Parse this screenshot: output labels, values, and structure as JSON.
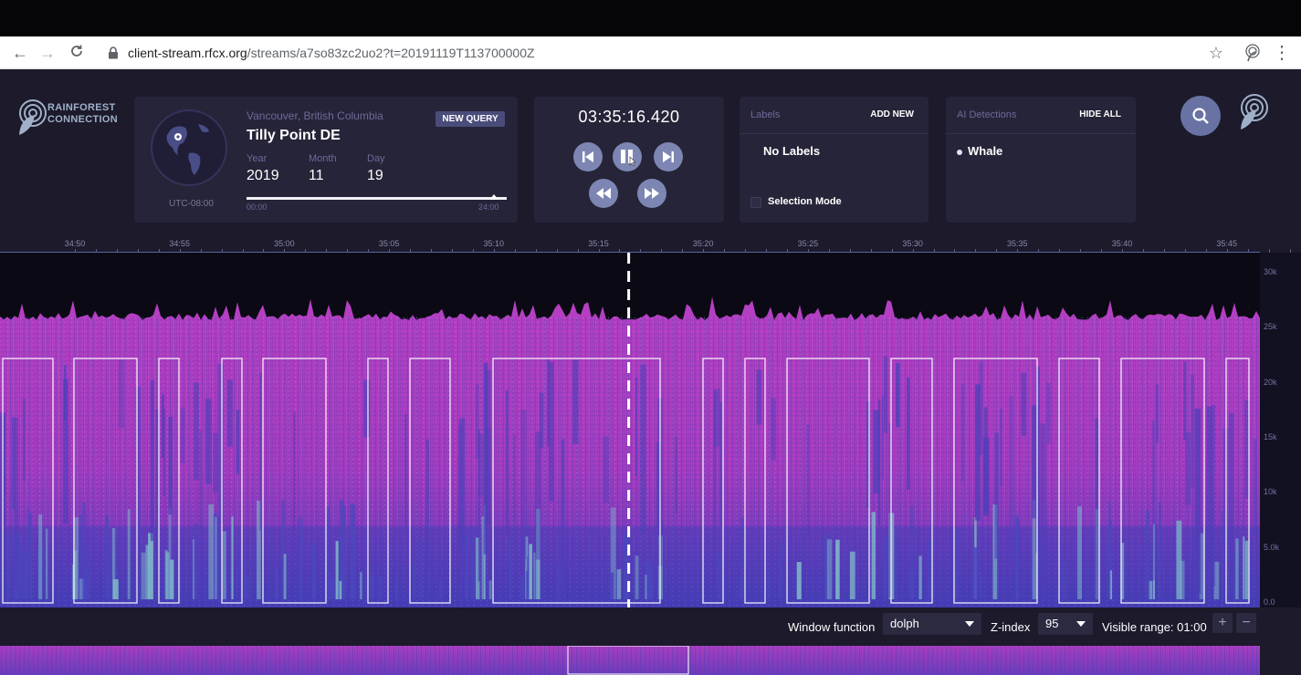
{
  "browser": {
    "url_host": "client-stream.rfcx.org",
    "url_path": "/streams/a7so83zc2uo2?t=20191119T113700000Z"
  },
  "brand": {
    "logo_line1": "RAINFOREST",
    "logo_line2": "CONNECTION",
    "accent": "#7d86b3",
    "panel_color": "#262438",
    "spectrogram_color": "#b63fc2"
  },
  "location": {
    "region": "Vancouver, British Columbia",
    "name": "Tilly Point DE",
    "new_query_label": "NEW QUERY",
    "timezone": "UTC-08:00",
    "year_label": "Year",
    "year": "2019",
    "month_label": "Month",
    "month": "11",
    "day_label": "Day",
    "day": "19",
    "timeline_start": "00:00",
    "timeline_end": "24:00",
    "timeline_position": 0.95
  },
  "player": {
    "time": "03:35:16.420"
  },
  "labels": {
    "title": "Labels",
    "add_label": "ADD NEW",
    "empty_text": "No Labels",
    "selection_mode_label": "Selection Mode"
  },
  "ai": {
    "title": "AI Detections",
    "hide_label": "HIDE ALL",
    "items": [
      "Whale"
    ]
  },
  "timeline_ticks": [
    "34:50",
    "34:55",
    "35:00",
    "35:05",
    "35:10",
    "35:15",
    "35:20",
    "35:25",
    "35:30",
    "35:35",
    "35:40",
    "35:45"
  ],
  "playhead_fraction": 0.499,
  "freq_axis": [
    "30k",
    "25k",
    "20k",
    "15k",
    "10k",
    "5.0k",
    "0.0"
  ],
  "controls": {
    "window_function_label": "Window function",
    "window_function_value": "dolph",
    "z_index_label": "Z-index",
    "z_index_value": "95",
    "visible_range_label": "Visible range: 01:00",
    "zoom_in": "+",
    "zoom_out": "−"
  }
}
